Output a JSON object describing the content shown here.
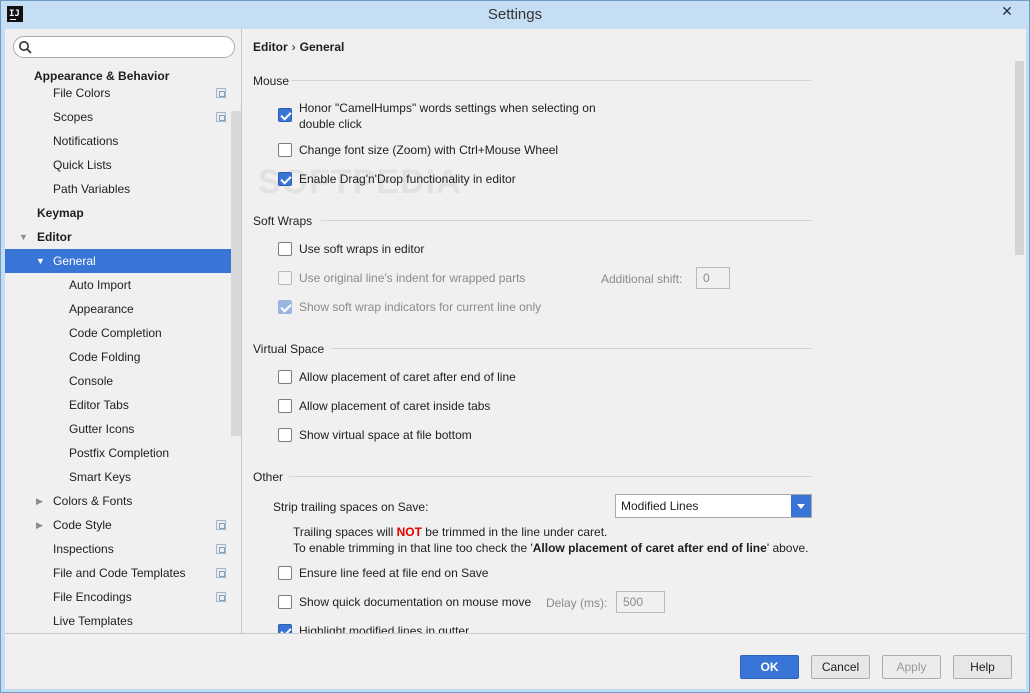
{
  "window": {
    "title": "Settings",
    "app_icon": "IJ",
    "close_glyph": "✕"
  },
  "sidebar": {
    "search": {
      "value": "",
      "placeholder": ""
    },
    "items": [
      {
        "label": "Appearance & Behavior"
      },
      {
        "label": "File Colors"
      },
      {
        "label": "Scopes"
      },
      {
        "label": "Notifications"
      },
      {
        "label": "Quick Lists"
      },
      {
        "label": "Path Variables"
      },
      {
        "label": "Keymap"
      },
      {
        "label": "Editor"
      },
      {
        "label": "General"
      },
      {
        "label": "Auto Import"
      },
      {
        "label": "Appearance"
      },
      {
        "label": "Code Completion"
      },
      {
        "label": "Code Folding"
      },
      {
        "label": "Console"
      },
      {
        "label": "Editor Tabs"
      },
      {
        "label": "Gutter Icons"
      },
      {
        "label": "Postfix Completion"
      },
      {
        "label": "Smart Keys"
      },
      {
        "label": "Colors & Fonts"
      },
      {
        "label": "Code Style"
      },
      {
        "label": "Inspections"
      },
      {
        "label": "File and Code Templates"
      },
      {
        "label": "File Encodings"
      },
      {
        "label": "Live Templates"
      }
    ]
  },
  "breadcrumb": {
    "parent": "Editor",
    "separator": "›",
    "current": "General"
  },
  "sections": {
    "mouse": {
      "title": "Mouse",
      "camel_humps_line1": "Honor \"CamelHumps\" words settings when selecting on",
      "camel_humps_line2": "double click",
      "camel_humps_checked": true,
      "zoom": "Change font size (Zoom) with Ctrl+Mouse Wheel",
      "zoom_checked": false,
      "dnd": "Enable Drag'n'Drop functionality in editor",
      "dnd_checked": true
    },
    "soft_wraps": {
      "title": "Soft Wraps",
      "use_soft_wraps": "Use soft wraps in editor",
      "use_original_indent": "Use original line's indent for wrapped parts",
      "additional_shift_label": "Additional shift:",
      "additional_shift_value": "0",
      "show_indicators": "Show soft wrap indicators for current line only"
    },
    "virtual_space": {
      "title": "Virtual Space",
      "after_end": "Allow placement of caret after end of line",
      "inside_tabs": "Allow placement of caret inside tabs",
      "file_bottom": "Show virtual space at file bottom"
    },
    "other": {
      "title": "Other",
      "strip_label": "Strip trailing spaces on Save:",
      "strip_value": "Modified Lines",
      "note_part1": "Trailing spaces will ",
      "note_not": "NOT",
      "note_part2": " be trimmed in the line under caret.",
      "note2_part1": "To enable trimming in that line too check the '",
      "note2_bold": "Allow placement of caret after end of line",
      "note2_part2": "' above.",
      "ensure_line_feed": "Ensure line feed at file end on Save",
      "quick_doc": "Show quick documentation on mouse move",
      "delay_label": "Delay (ms):",
      "delay_value": "500",
      "highlight_modified": "Highlight modified lines in gutter"
    }
  },
  "footer": {
    "ok": "OK",
    "cancel": "Cancel",
    "apply": "Apply",
    "help": "Help"
  },
  "watermark": "SOFTPEDIA",
  "colors": {
    "accent": "#3875d7",
    "warning": "#e00000",
    "titlebar": "#c6def4"
  }
}
